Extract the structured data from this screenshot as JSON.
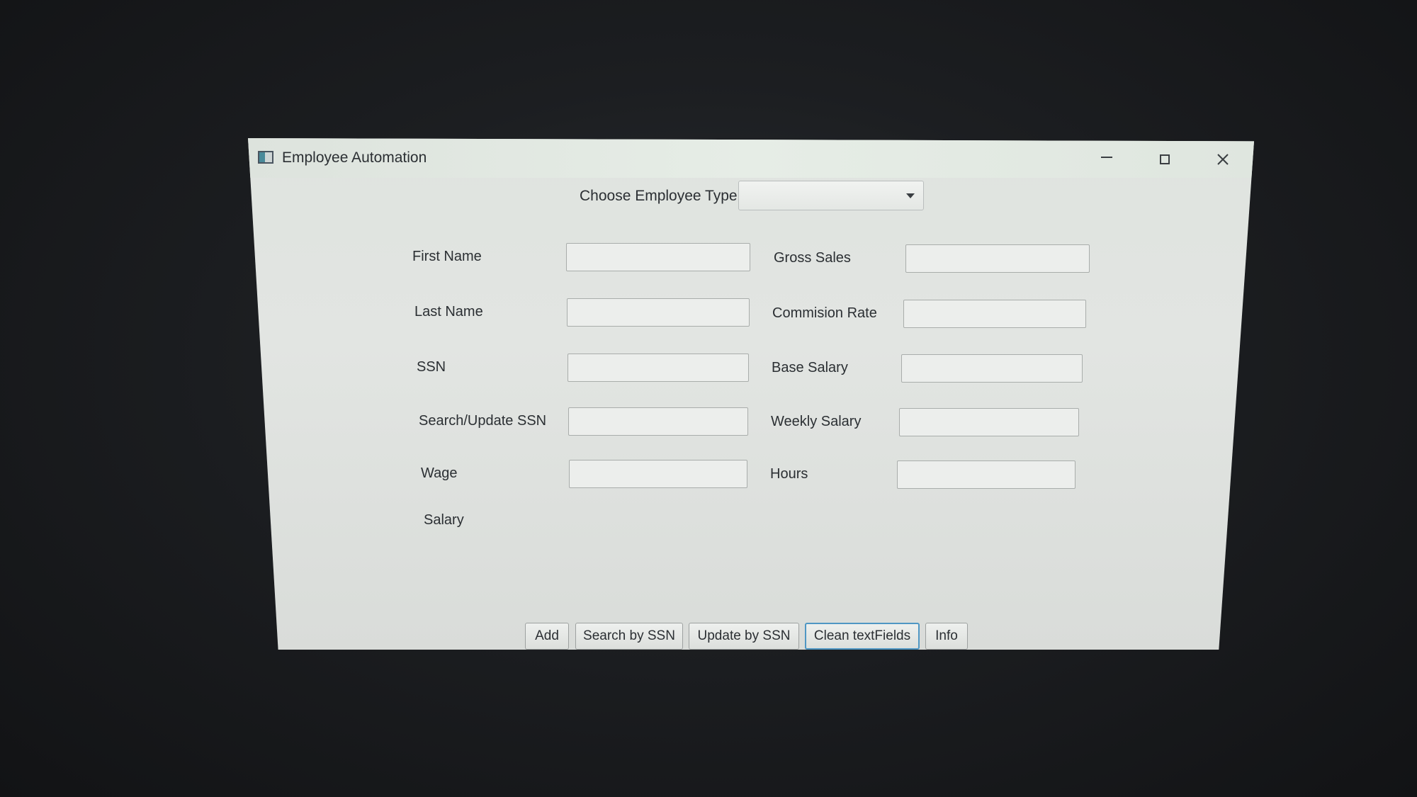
{
  "window": {
    "title": "Employee Automation",
    "controls": {
      "minimize_icon": "minimize-icon",
      "maximize_icon": "maximize-icon",
      "close_icon": "close-icon"
    }
  },
  "employee_type": {
    "label": "Choose Employee Type",
    "selected": ""
  },
  "left_fields": [
    {
      "label": "First Name",
      "value": ""
    },
    {
      "label": "Last Name",
      "value": ""
    },
    {
      "label": "SSN",
      "value": ""
    },
    {
      "label": "Search/Update SSN",
      "value": ""
    },
    {
      "label": "Wage",
      "value": ""
    }
  ],
  "right_fields": [
    {
      "label": "Gross Sales",
      "value": ""
    },
    {
      "label": "Commision Rate",
      "value": ""
    },
    {
      "label": "Base Salary",
      "value": ""
    },
    {
      "label": "Weekly Salary",
      "value": ""
    },
    {
      "label": "Hours",
      "value": ""
    }
  ],
  "salary_label": "Salary",
  "buttons": {
    "add": "Add",
    "search": "Search by SSN",
    "update": "Update by SSN",
    "clean": "Clean textFields",
    "info": "Info"
  }
}
